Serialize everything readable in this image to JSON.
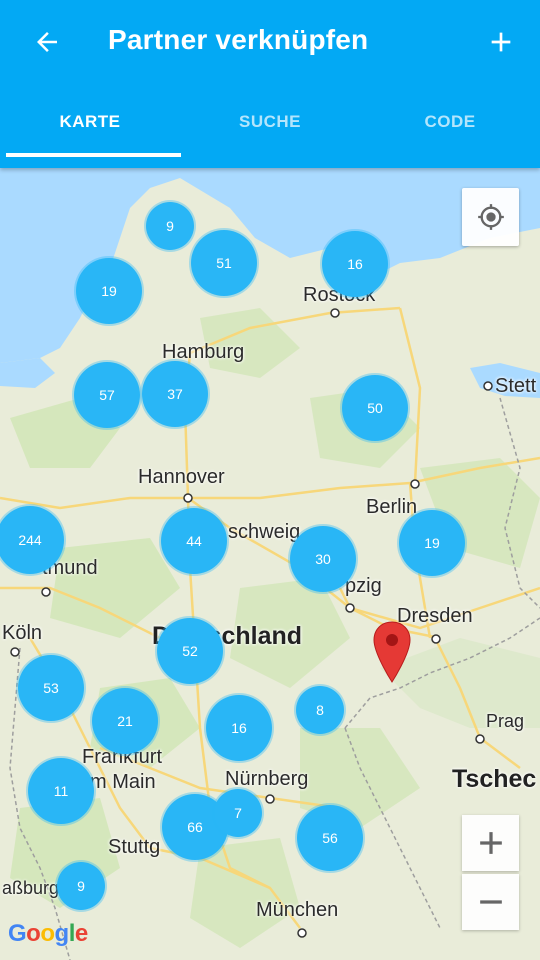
{
  "toolbar": {
    "title": "Partner verknüpfen",
    "back_icon": "arrow-back-icon",
    "add_icon": "plus-icon"
  },
  "tabs": [
    {
      "label": "KARTE",
      "active": true
    },
    {
      "label": "SUCHE",
      "active": false
    },
    {
      "label": "CODE",
      "active": false
    }
  ],
  "map": {
    "cities": {
      "rostock": "Rostock",
      "stettin": "Stett",
      "hamburg": "Hamburg",
      "hannover": "Hannover",
      "braunschweig": "schweig",
      "berlin": "Berlin",
      "dortmund": "tmund",
      "leipzig": "pzig",
      "dresden": "Dresden",
      "koeln": "Köln",
      "prag": "Prag",
      "frankfurt_1": "Frankfurt",
      "frankfurt_2": "m Main",
      "nuernberg": "Nürnberg",
      "stuttgart": "Stuttg",
      "strasbourg": "aßburg",
      "muenchen": "München"
    },
    "countries": {
      "germany": "Deutschland",
      "czech": "Tschec"
    },
    "clusters": [
      "9",
      "51",
      "16",
      "19",
      "57",
      "37",
      "50",
      "244",
      "44",
      "30",
      "19",
      "52",
      "53",
      "21",
      "16",
      "8",
      "11",
      "66",
      "7",
      "56",
      "9"
    ],
    "google_logo": {
      "g1": "G",
      "o1": "o",
      "o2": "o",
      "g2": "g",
      "l": "l",
      "e": "e"
    },
    "colors": {
      "cluster": "#29b6f6",
      "marker": "#e53935",
      "appbar": "#03a9f4"
    }
  }
}
